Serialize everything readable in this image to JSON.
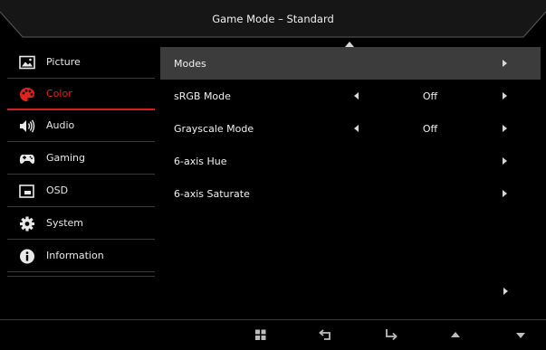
{
  "header": {
    "title": "Game Mode – Standard"
  },
  "sidebar": {
    "items": [
      {
        "label": "Picture",
        "icon": "picture-icon",
        "active": false
      },
      {
        "label": "Color",
        "icon": "palette-icon",
        "active": true
      },
      {
        "label": "Audio",
        "icon": "speaker-icon",
        "active": false
      },
      {
        "label": "Gaming",
        "icon": "gamepad-icon",
        "active": false
      },
      {
        "label": "OSD",
        "icon": "osd-icon",
        "active": false
      },
      {
        "label": "System",
        "icon": "gear-icon",
        "active": false
      },
      {
        "label": "Information",
        "icon": "info-icon",
        "active": false
      }
    ]
  },
  "panel": {
    "rows": [
      {
        "label": "Modes",
        "value": "",
        "highlighted": true
      },
      {
        "label": "sRGB Mode",
        "value": "Off",
        "highlighted": false
      },
      {
        "label": "Grayscale Mode",
        "value": "Off",
        "highlighted": false
      },
      {
        "label": "6-axis Hue",
        "value": "",
        "highlighted": false
      },
      {
        "label": "6-axis Saturate",
        "value": "",
        "highlighted": false
      }
    ]
  },
  "footer": {
    "buttons": [
      "menu-grid-icon",
      "back-icon",
      "enter-icon",
      "up-icon",
      "down-icon"
    ]
  },
  "colors": {
    "background": "#000000",
    "accent_red": "#e0241e",
    "highlight_row": "#3c3c3c",
    "header_frame": "#333333"
  }
}
